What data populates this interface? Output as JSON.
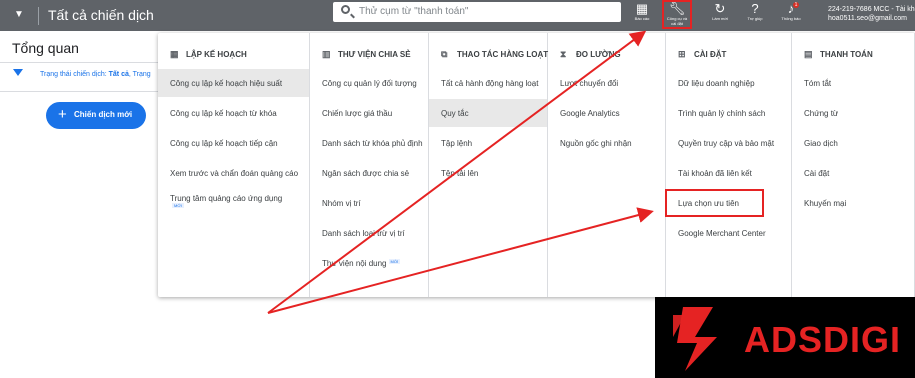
{
  "topbar": {
    "title": "Tất cả chiến dịch",
    "search_placeholder": "Thử cụm từ \"thanh toán\"",
    "items": [
      {
        "label": "Báo cáo",
        "icon": "reports-icon"
      },
      {
        "label": "Công cụ và cài đặt",
        "icon": "tools-icon"
      },
      {
        "label": "Làm mới",
        "icon": "refresh-icon"
      },
      {
        "label": "Trợ giúp",
        "icon": "help-icon"
      },
      {
        "label": "Thông báo",
        "icon": "bell-icon",
        "count": "1"
      }
    ],
    "account_line1": "224-219-7686 MCC - Tài khoản",
    "account_line2": "hoa0511.seo@gmail.com"
  },
  "page": {
    "overview": "Tổng quan",
    "filter_prefix": "Trạng thái chiến dịch: ",
    "filter_value": "Tất cả",
    "filter_suffix": ", Trạng",
    "new_campaign": "Chiến dịch mới"
  },
  "menu": {
    "columns": [
      {
        "header": "LẬP KẾ HOẠCH",
        "icon": "calendar-icon",
        "items": [
          "Công cụ lập kế hoạch hiệu suất",
          "Công cụ lập kế hoạch từ khóa",
          "Công cụ lập kế hoạch tiếp cận",
          "Xem trước và chẩn đoán quảng cáo",
          "Trung tâm quảng cáo ứng dụng"
        ],
        "badge": "MỚI"
      },
      {
        "header": "THƯ VIỆN CHIA SẺ",
        "icon": "library-icon",
        "items": [
          "Công cụ quản lý đối tượng",
          "Chiến lược giá thầu",
          "Danh sách từ khóa phủ định",
          "Ngân sách được chia sẻ",
          "Nhóm vị trí",
          "Danh sách loại trừ vị trí",
          "Thư viện nội dung"
        ],
        "badge": "MỚI"
      },
      {
        "header": "THAO TÁC HÀNG LOẠT",
        "icon": "bulk-actions-icon",
        "items": [
          "Tất cả hành động hàng loạt",
          "Quy tắc",
          "Tập lệnh",
          "Tệp tải lên"
        ]
      },
      {
        "header": "ĐO LƯỜNG",
        "icon": "hourglass-icon",
        "items": [
          "Lượt chuyển đổi",
          "Google Analytics",
          "Nguồn gốc ghi nhận"
        ]
      },
      {
        "header": "CÀI ĐẶT",
        "icon": "settings-grid-icon",
        "items": [
          "Dữ liệu doanh nghiệp",
          "Trình quản lý chính sách",
          "Quyền truy cập và bảo mật",
          "Tài khoản đã liên kết",
          "Lựa chọn ưu tiên",
          "Google Merchant Center"
        ]
      },
      {
        "header": "THANH TOÁN",
        "icon": "billing-icon",
        "items": [
          "Tóm tắt",
          "Chứng từ",
          "Giao dịch",
          "Cài đặt",
          "Khuyến mại"
        ]
      }
    ]
  },
  "logo": {
    "text": "ADSDIGI"
  },
  "colors": {
    "accent": "#1a73e8",
    "highlight": "#e52323",
    "topbar": "#5f6368"
  }
}
